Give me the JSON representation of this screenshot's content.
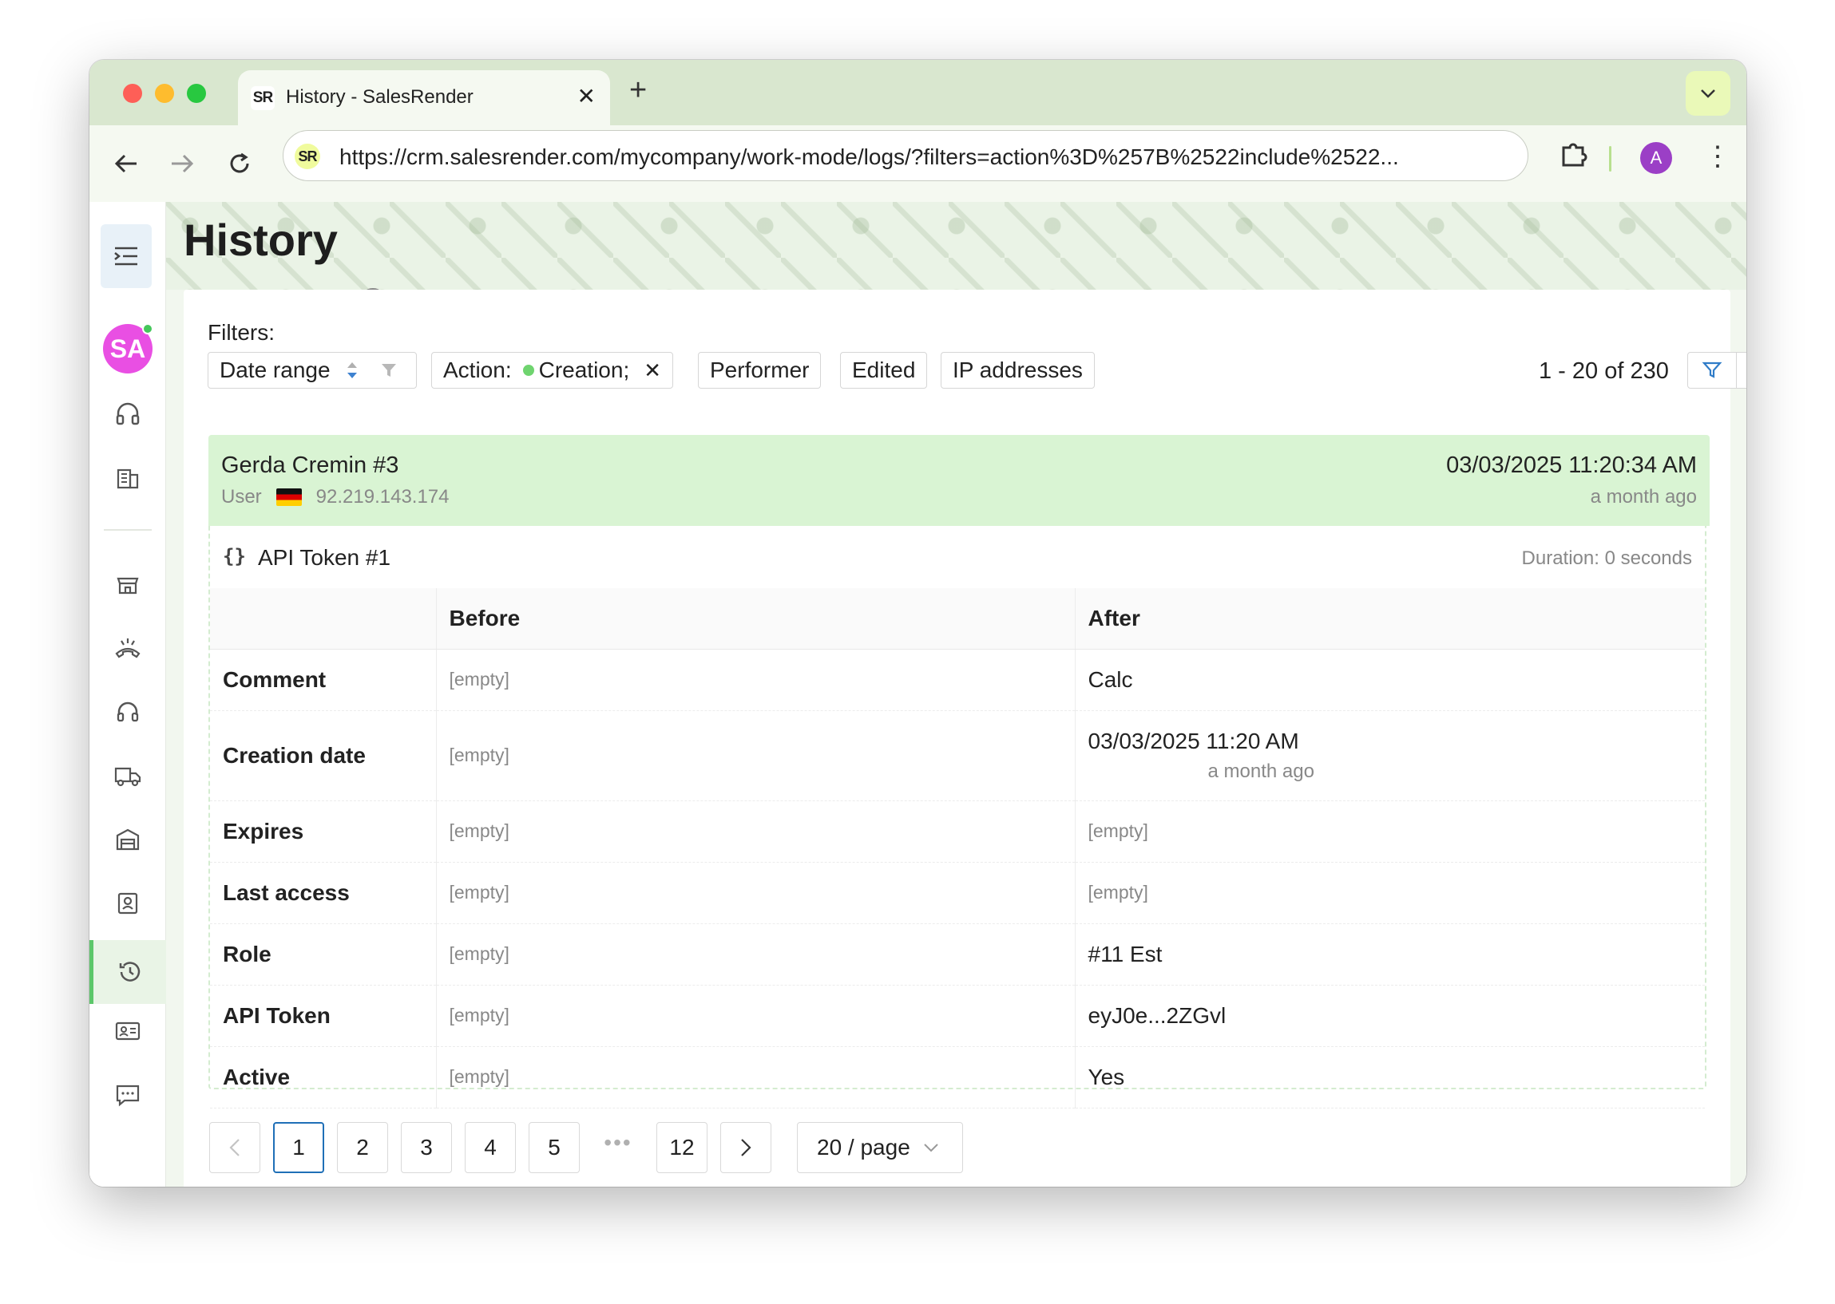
{
  "browser": {
    "tab_title": "History - SalesRender",
    "tab_favicon": "SR",
    "url": "https://crm.salesrender.com/mycompany/work-mode/logs/?filters=action%3D%257B%2522include%2522...",
    "profile_initial": "A"
  },
  "sidebar": {
    "avatar_initials": "SA",
    "items": [
      "headset-icon",
      "building-icon",
      "store-icon",
      "call-icon",
      "support-icon",
      "truck-icon",
      "warehouse-icon",
      "contact-icon",
      "history-icon",
      "id-card-icon",
      "chat-icon"
    ],
    "active": "history-icon"
  },
  "page": {
    "title": "History"
  },
  "filters": {
    "label": "Filters:",
    "date_range": "Date range",
    "action_label": "Action:",
    "action_value": "Creation;",
    "performer": "Performer",
    "edited": "Edited",
    "ip": "IP addresses",
    "count": "1 - 20 of 230"
  },
  "record": {
    "performer": "Gerda Cremin #3",
    "performer_type": "User",
    "ip": "92.219.143.174",
    "date": "03/03/2025 11:20:34 AM",
    "ago": "a month ago",
    "entity_icon": "{}",
    "entity": "API Token #1",
    "duration": "Duration: 0 seconds",
    "columns": {
      "before": "Before",
      "after": "After"
    },
    "rows": [
      {
        "prop": "Comment",
        "before": "[empty]",
        "after": "Calc"
      },
      {
        "prop": "Creation date",
        "before": "[empty]",
        "after": "03/03/2025 11:20 AM",
        "after_sub": "a month ago"
      },
      {
        "prop": "Expires",
        "before": "[empty]",
        "after": "[empty]"
      },
      {
        "prop": "Last access",
        "before": "[empty]",
        "after": "[empty]"
      },
      {
        "prop": "Role",
        "before": "[empty]",
        "after": "#11 Est"
      },
      {
        "prop": "API Token",
        "before": "[empty]",
        "after": "eyJ0e...2ZGvl"
      },
      {
        "prop": "Active",
        "before": "[empty]",
        "after": "Yes"
      }
    ]
  },
  "pagination": {
    "pages": [
      "1",
      "2",
      "3",
      "4",
      "5"
    ],
    "ellipsis": "•••",
    "last": "12",
    "current": "1",
    "page_size": "20 / page"
  },
  "colors": {
    "record_header": "#d9f4d3",
    "active_page_border": "#1f6fb7",
    "avatar": "#e94fe3",
    "accent_green": "#5cc76a"
  }
}
